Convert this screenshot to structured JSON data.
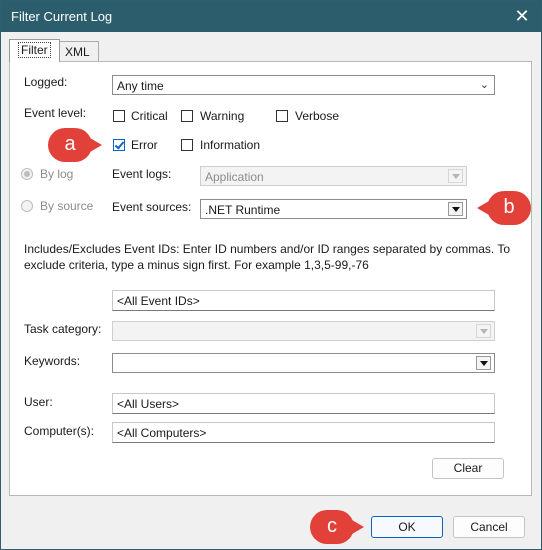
{
  "window": {
    "title": "Filter Current Log",
    "close_glyph": "✕"
  },
  "tabs": [
    {
      "label": "Filter"
    },
    {
      "label": "XML"
    }
  ],
  "logged": {
    "label": "Logged:",
    "value": "Any time",
    "chevron": "⌄"
  },
  "event_level": {
    "label": "Event level:",
    "options": [
      {
        "label": "Critical",
        "checked": false
      },
      {
        "label": "Warning",
        "checked": false
      },
      {
        "label": "Verbose",
        "checked": false
      },
      {
        "label": "Error",
        "checked": true
      },
      {
        "label": "Information",
        "checked": false
      }
    ]
  },
  "by_log": {
    "label": "By log",
    "selected": true
  },
  "by_source": {
    "label": "By source",
    "selected": false
  },
  "event_logs": {
    "label": "Event logs:",
    "value": "Application"
  },
  "event_sources": {
    "label": "Event sources:",
    "value": ".NET Runtime"
  },
  "event_ids": {
    "description": "Includes/Excludes Event IDs: Enter ID numbers and/or ID ranges separated by commas. To exclude criteria, type a minus sign first. For example 1,3,5-99,-76",
    "value": "<All Event IDs>"
  },
  "task_category": {
    "label": "Task category:",
    "value": ""
  },
  "keywords": {
    "label": "Keywords:",
    "value": ""
  },
  "user": {
    "label": "User:",
    "value": "<All Users>"
  },
  "computers": {
    "label": "Computer(s):",
    "value": "<All Computers>"
  },
  "buttons": {
    "clear": "Clear",
    "ok": "OK",
    "cancel": "Cancel"
  },
  "callouts": {
    "a": "a",
    "b": "b",
    "c": "c"
  },
  "colors": {
    "titlebar": "#2c5d6c",
    "callout": "#e2413a",
    "accent": "#0a64c4"
  }
}
